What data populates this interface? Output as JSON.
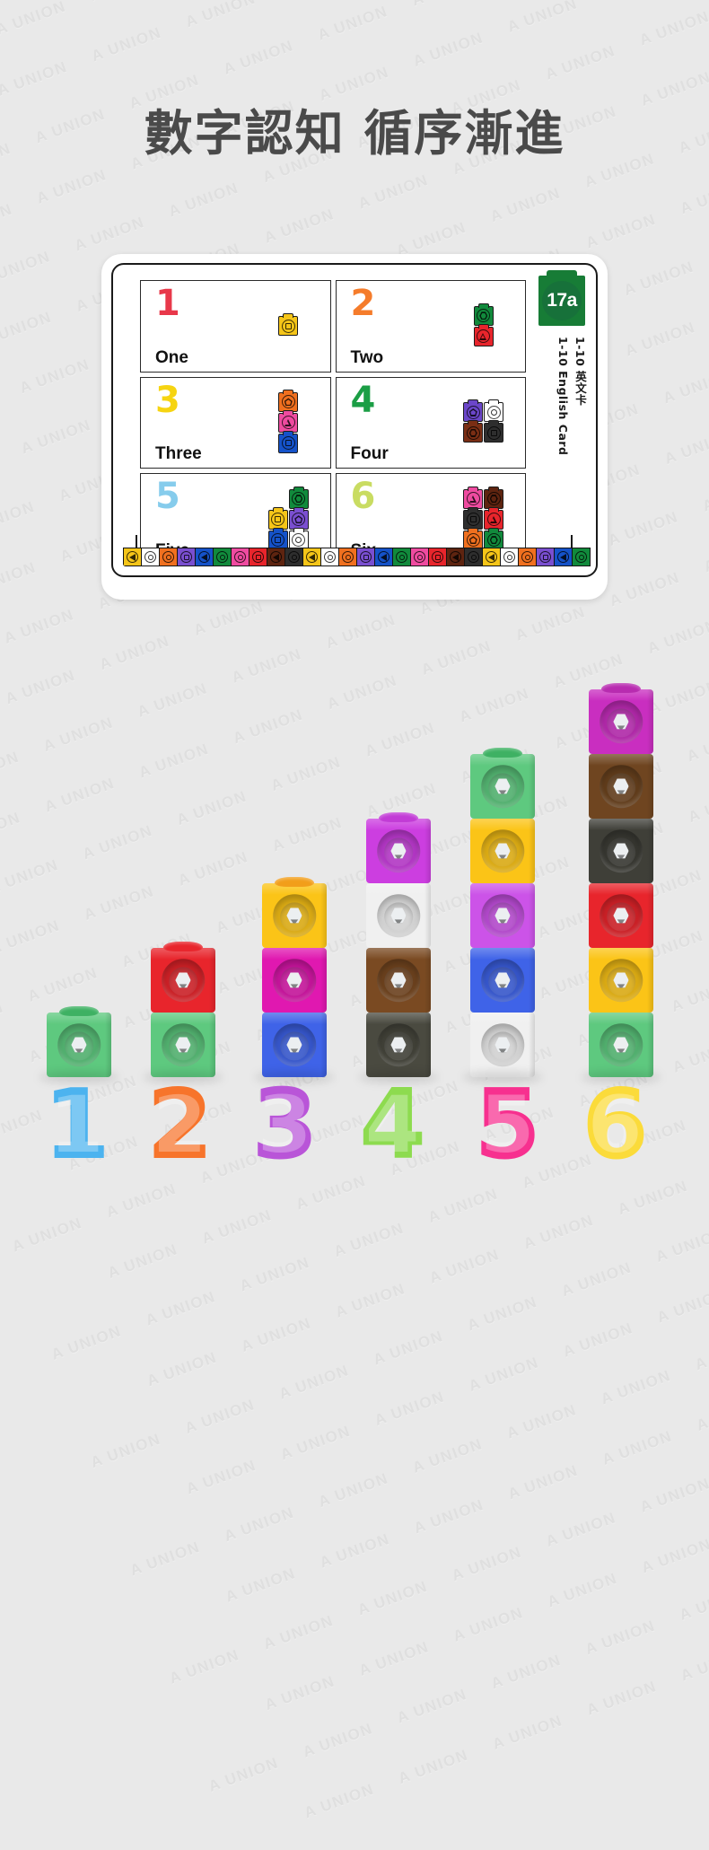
{
  "page": {
    "background_color": "#e9e9e9",
    "watermark_text": "A UNION",
    "title": "數字認知  循序漸進"
  },
  "card": {
    "badge": "17a",
    "badge_color": "#177c36",
    "sidebar_line_cn": "1-10 英文卡",
    "sidebar_line_en": "1-10 English Card",
    "cells": [
      {
        "digit": "1",
        "word": "One",
        "digit_color": "#e8384a",
        "layout": "single",
        "blocks": [
          {
            "color": "#f5c518",
            "shape": "square"
          }
        ]
      },
      {
        "digit": "2",
        "word": "Two",
        "digit_color": "#f57c2b",
        "layout": "column-1",
        "blocks": [
          {
            "color": "#118a3c",
            "shape": "hexagon"
          },
          {
            "color": "#e8252c",
            "shape": "triangle"
          }
        ]
      },
      {
        "digit": "3",
        "word": "Three",
        "digit_color": "#f6d411",
        "layout": "column-1",
        "blocks": [
          {
            "color": "#f0701f",
            "shape": "pentagon"
          },
          {
            "color": "#ef4ba0",
            "shape": "triangle"
          },
          {
            "color": "#1552c9",
            "shape": "square"
          }
        ]
      },
      {
        "digit": "4",
        "word": "Four",
        "digit_color": "#1b9e45",
        "layout": "grid-2",
        "blocks": [
          {
            "color": "#6b46c9",
            "shape": "pentagon"
          },
          {
            "color": "#ffffff",
            "shape": "circle"
          },
          {
            "color": "#7a2e14",
            "shape": "hexagon"
          },
          {
            "color": "#2e2e2e",
            "shape": "square"
          }
        ]
      },
      {
        "digit": "5",
        "word": "Five",
        "digit_color": "#86ccec",
        "layout": "pyramid-5",
        "blocks": [
          {
            "color": "#118a3c",
            "shape": "hexagon"
          },
          {
            "color": "#f5c518",
            "shape": "square"
          },
          {
            "color": "#7a4fd0",
            "shape": "pentagon"
          },
          {
            "color": "#1552c9",
            "shape": "square"
          },
          {
            "color": "#ffffff",
            "shape": "circle"
          }
        ]
      },
      {
        "digit": "6",
        "word": "Six",
        "digit_color": "#c9dc62",
        "layout": "grid-2",
        "blocks": [
          {
            "color": "#ef4ba0",
            "shape": "triangle"
          },
          {
            "color": "#5e2410",
            "shape": "hexagon"
          },
          {
            "color": "#2e2e2e",
            "shape": "square"
          },
          {
            "color": "#e8252c",
            "shape": "triangle"
          },
          {
            "color": "#f0701f",
            "shape": "pentagon"
          },
          {
            "color": "#118a3c",
            "shape": "hexagon"
          }
        ]
      }
    ],
    "strip_palette": [
      {
        "color": "#f5c518",
        "shape": "triangle"
      },
      {
        "color": "#ffffff",
        "shape": "circle"
      },
      {
        "color": "#f0701f",
        "shape": "circle"
      },
      {
        "color": "#7a4fd0",
        "shape": "square"
      },
      {
        "color": "#1552c9",
        "shape": "triangle"
      },
      {
        "color": "#118a3c",
        "shape": "circle"
      },
      {
        "color": "#ef4ba0",
        "shape": "circle"
      },
      {
        "color": "#e8252c",
        "shape": "square"
      },
      {
        "color": "#5e2410",
        "shape": "triangle"
      },
      {
        "color": "#2e2e2e",
        "shape": "circle"
      }
    ]
  },
  "photo": {
    "stacks": [
      {
        "count": 1,
        "cubes": [
          "#5ec97f"
        ],
        "stud": "#3eb163"
      },
      {
        "count": 2,
        "cubes": [
          "#e8252c",
          "#5ec97f"
        ],
        "stud": "#e8252c"
      },
      {
        "count": 3,
        "cubes": [
          "#fbc417",
          "#e018b0",
          "#3f63e8"
        ],
        "stud": "#f29e1a"
      },
      {
        "count": 4,
        "cubes": [
          "#cc3ee0",
          "#f0f0f0",
          "#7a4a22",
          "#4a4a40"
        ],
        "stud": "#c23bd6"
      },
      {
        "count": 5,
        "cubes": [
          "#5ec97f",
          "#fbc417",
          "#cc53e8",
          "#3f63e8",
          "#f0f0f0"
        ],
        "stud": "#3eb163"
      },
      {
        "count": 6,
        "cubes": [
          "#c92ec0",
          "#6f4520",
          "#3f3f38",
          "#e8252c",
          "#fbc417",
          "#5ec97f"
        ],
        "stud": "#b82bb0"
      }
    ],
    "numerals": [
      {
        "ch": "1",
        "color": "#4cb3ef"
      },
      {
        "ch": "2",
        "color": "#f7742b"
      },
      {
        "ch": "3",
        "color": "#b955d8"
      },
      {
        "ch": "4",
        "color": "#8ddb4f"
      },
      {
        "ch": "5",
        "color": "#f7308f"
      },
      {
        "ch": "6",
        "color": "#fbdb3a"
      }
    ]
  }
}
